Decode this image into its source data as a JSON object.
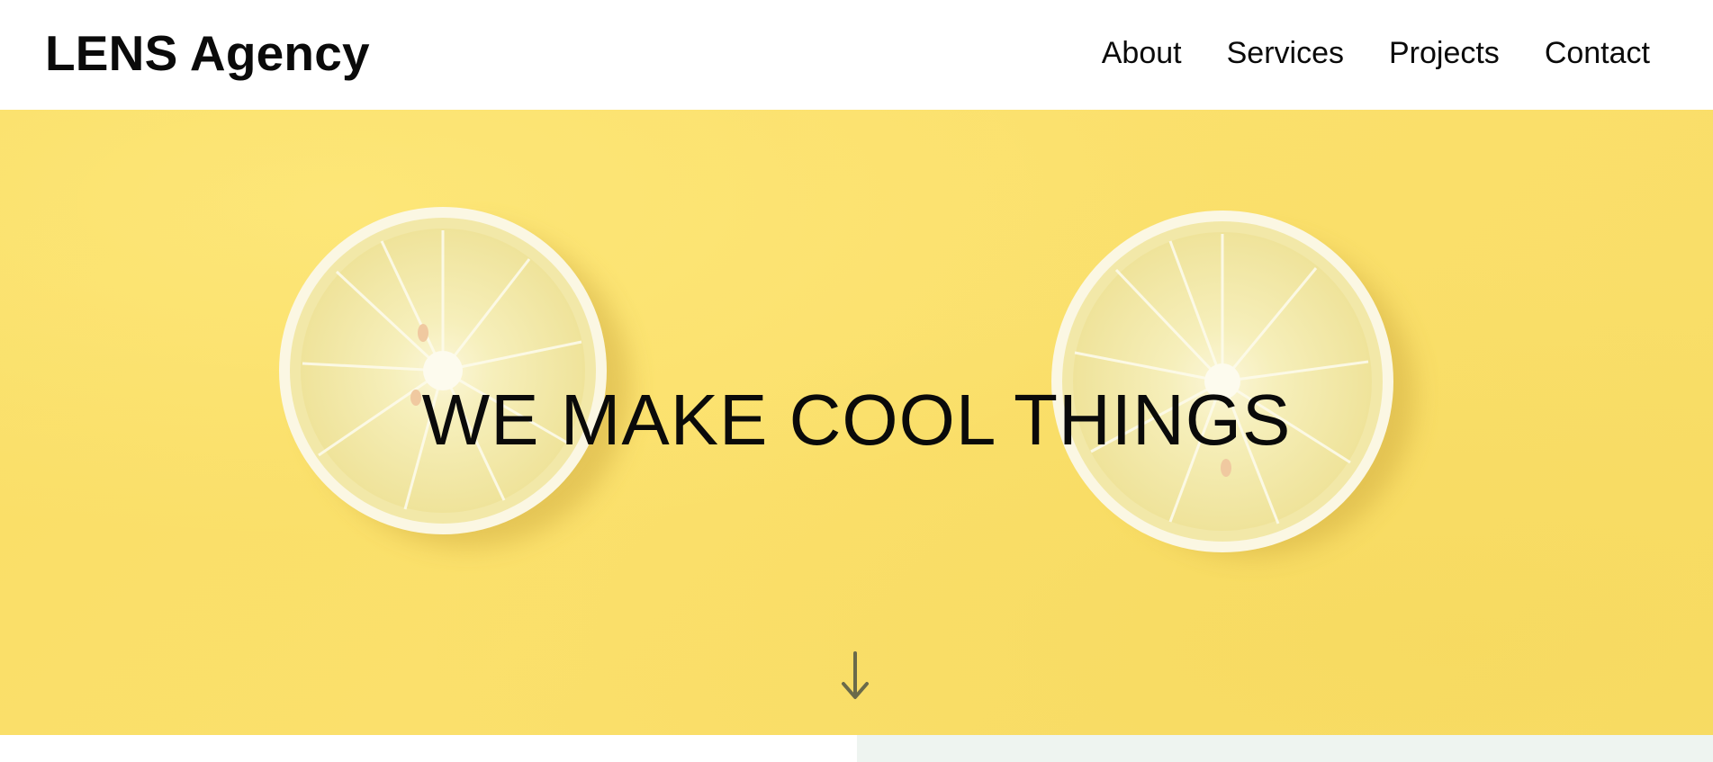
{
  "header": {
    "brand": "LENS Agency",
    "nav": [
      {
        "label": "About"
      },
      {
        "label": "Services"
      },
      {
        "label": "Projects"
      },
      {
        "label": "Contact"
      }
    ]
  },
  "hero": {
    "title": "WE MAKE COOL THINGS",
    "background_color": "#fbe06c",
    "scroll_icon": "arrow-down-icon"
  },
  "colors": {
    "header_bg": "#ffffff",
    "text": "#0a0a0a",
    "lemon_flesh": "#f5eeb2",
    "lemon_rind": "#fbf7e0"
  }
}
